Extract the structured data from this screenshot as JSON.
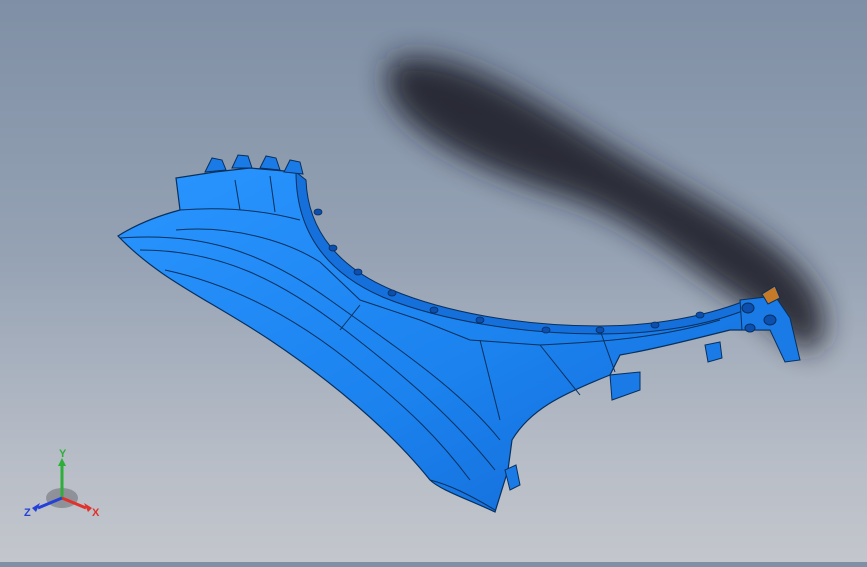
{
  "viewport": {
    "background_top": "#7f8fa5",
    "background_bottom": "#c3c6cc",
    "model": {
      "part_color": "#1f86f0",
      "part_dark": "#0f5fc8",
      "edge_color": "#08305e",
      "highlight_color": "#c57a2a",
      "shadow_color": "#1b1f26"
    }
  },
  "triad": {
    "x_label": "X",
    "y_label": "Y",
    "z_label": "Z",
    "x_color": "#e0312a",
    "y_color": "#2fae3a",
    "z_color": "#2340d8"
  }
}
